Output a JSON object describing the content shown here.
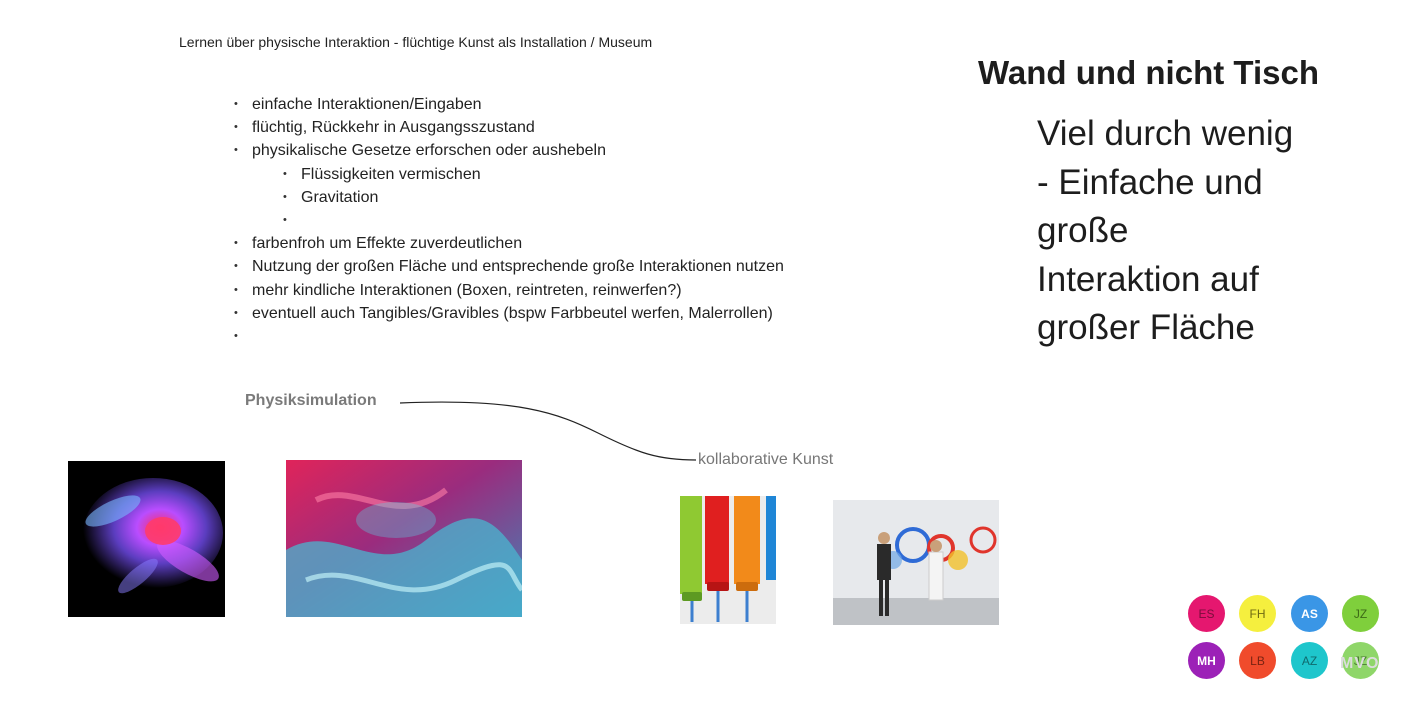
{
  "header": {
    "subtitle": "Lernen über physische Interaktion - flüchtige Kunst als Installation / Museum"
  },
  "notes": [
    {
      "text": "einfache Interaktionen/Eingaben"
    },
    {
      "text": "flüchtig, Rückkehr in Ausgangsszustand"
    },
    {
      "text": "physikalische Gesetze erforschen oder aushebeln"
    },
    {
      "text": "Flüssigkeiten vermischen"
    },
    {
      "text": "Gravitation"
    },
    {
      "text": ""
    },
    {
      "text": "farbenfroh um Effekte zuverdeutlichen"
    },
    {
      "text": "Nutzung der großen Fläche und entsprechende große Interaktionen nutzen"
    },
    {
      "text": "mehr kindliche Interaktionen (Boxen, reintreten, reinwerfen?)"
    },
    {
      "text": "eventuell auch Tangibles/Gravibles (bspw Farbbeutel werfen, Malerrollen)"
    },
    {
      "text": ""
    }
  ],
  "wand": {
    "title": "Wand und nicht Tisch",
    "lines": [
      "Viel durch wenig",
      "- Einfache und",
      "große",
      "Interaktion auf",
      "großer Fläche"
    ]
  },
  "labels": {
    "physik": "Physiksimulation",
    "kollab": "kollaborative Kunst"
  },
  "collaborators": [
    {
      "initials": "ES",
      "color": "#e5176f"
    },
    {
      "initials": "FH",
      "color": "#f5ef3e"
    },
    {
      "initials": "AS",
      "color": "#3a96e6"
    },
    {
      "initials": "JZ",
      "color": "#7fcf3c"
    },
    {
      "initials": "MH",
      "color": "#9c21b7"
    },
    {
      "initials": "LB",
      "color": "#f04b2c"
    },
    {
      "initials": "AZ",
      "color": "#1ec6cc"
    },
    {
      "initials": "JZ",
      "color": "#8fd669"
    }
  ],
  "watermark": "MVO"
}
